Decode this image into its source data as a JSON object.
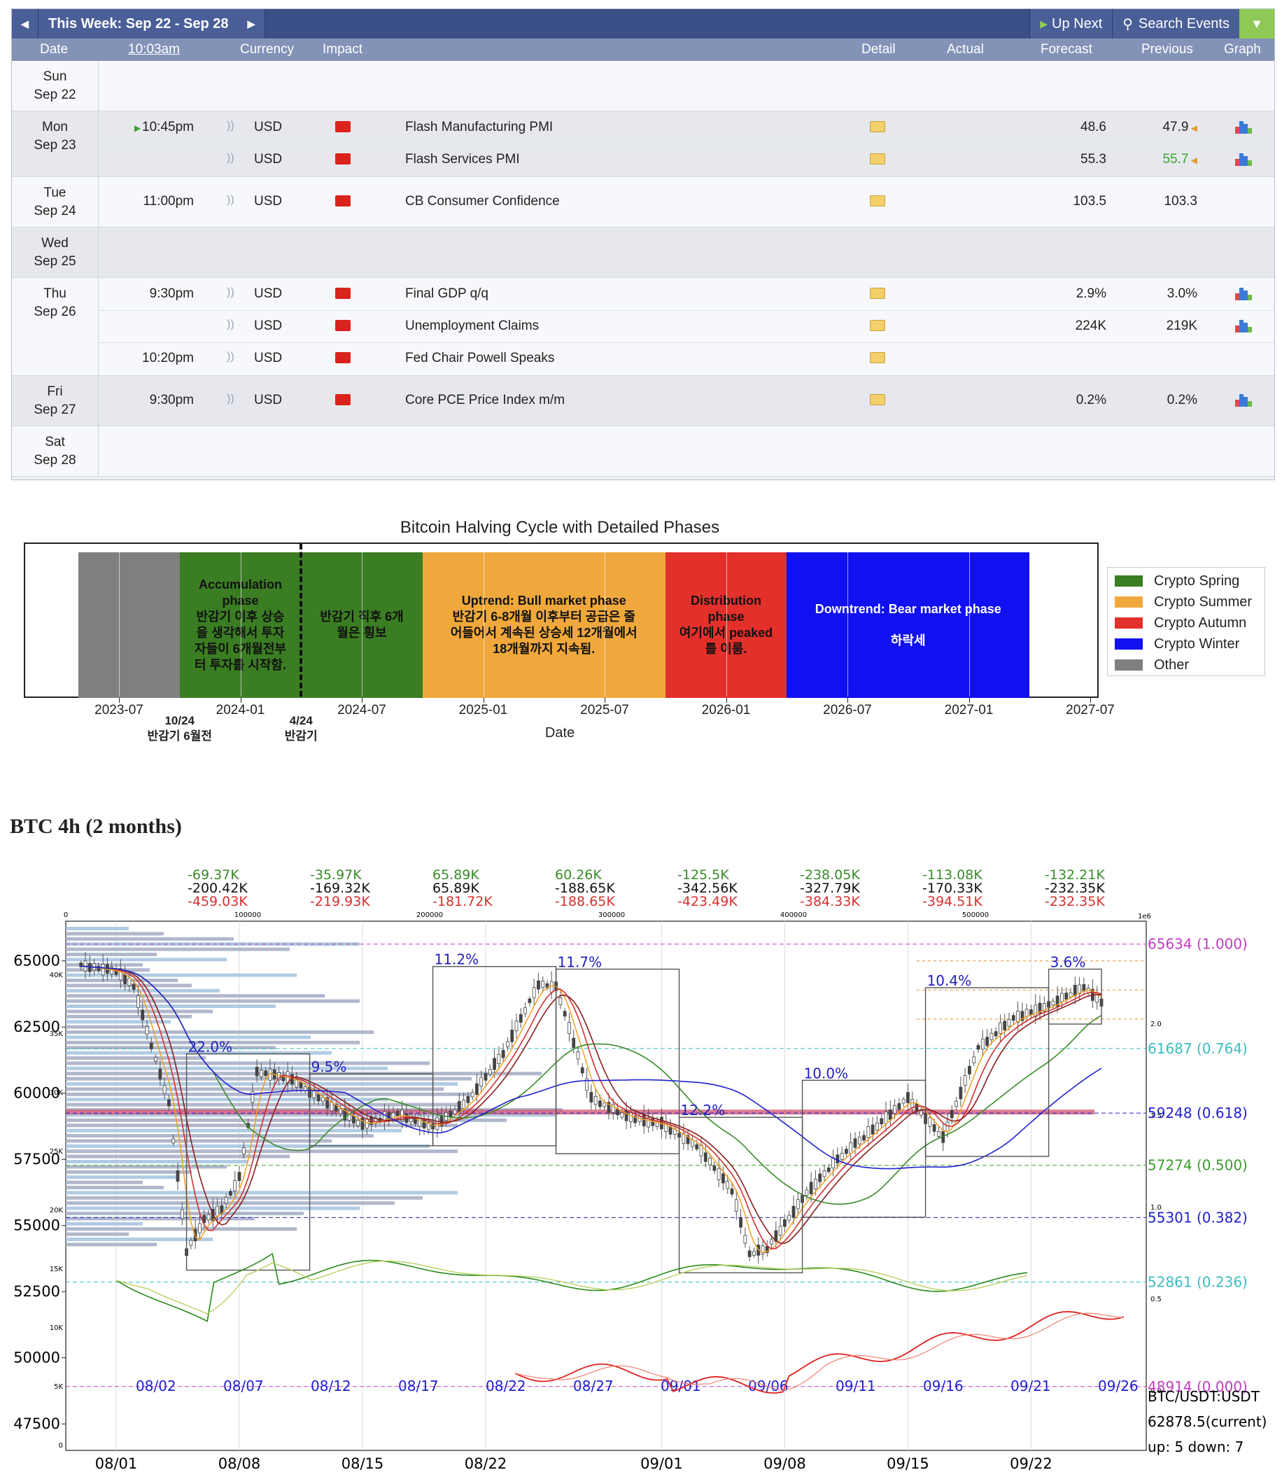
{
  "calendar": {
    "week_label": "This Week: Sep 22 - Sep 28",
    "up_next": "Up Next",
    "search": "Search Events",
    "headers": {
      "date": "Date",
      "time": "10:03am",
      "currency": "Currency",
      "impact": "Impact",
      "detail": "Detail",
      "actual": "Actual",
      "forecast": "Forecast",
      "previous": "Previous",
      "graph": "Graph"
    },
    "days": [
      {
        "dow": "Sun",
        "date": "Sep 22",
        "events": []
      },
      {
        "dow": "Mon",
        "date": "Sep 23",
        "events": [
          {
            "time": "10:45pm",
            "currency": "USD",
            "name": "Flash Manufacturing PMI",
            "actual": "",
            "forecast": "48.6",
            "previous": "47.9",
            "prev_color": "#222",
            "graph": true
          },
          {
            "time": "",
            "currency": "USD",
            "name": "Flash Services PMI",
            "actual": "",
            "forecast": "55.3",
            "previous": "55.7",
            "prev_color": "#3aa62e",
            "graph": true
          }
        ]
      },
      {
        "dow": "Tue",
        "date": "Sep 24",
        "events": [
          {
            "time": "11:00pm",
            "currency": "USD",
            "name": "CB Consumer Confidence",
            "actual": "",
            "forecast": "103.5",
            "previous": "103.3",
            "prev_color": "#222",
            "graph": false
          }
        ]
      },
      {
        "dow": "Wed",
        "date": "Sep 25",
        "events": []
      },
      {
        "dow": "Thu",
        "date": "Sep 26",
        "events": [
          {
            "time": "9:30pm",
            "currency": "USD",
            "name": "Final GDP q/q",
            "actual": "",
            "forecast": "2.9%",
            "previous": "3.0%",
            "prev_color": "#222",
            "graph": true
          },
          {
            "time": "",
            "currency": "USD",
            "name": "Unemployment Claims",
            "actual": "",
            "forecast": "224K",
            "previous": "219K",
            "prev_color": "#222",
            "graph": true
          },
          {
            "time": "10:20pm",
            "currency": "USD",
            "name": "Fed Chair Powell Speaks",
            "actual": "",
            "forecast": "",
            "previous": "",
            "prev_color": "#222",
            "graph": false
          }
        ]
      },
      {
        "dow": "Fri",
        "date": "Sep 27",
        "events": [
          {
            "time": "9:30pm",
            "currency": "USD",
            "name": "Core PCE Price Index m/m",
            "actual": "",
            "forecast": "0.2%",
            "previous": "0.2%",
            "prev_color": "#222",
            "graph": true
          }
        ]
      },
      {
        "dow": "Sat",
        "date": "Sep 28",
        "events": []
      }
    ]
  },
  "halving": {
    "title": "Bitcoin Halving Cycle with Detailed Phases",
    "xlabel": "Date",
    "x_ticks": [
      "2023-07",
      "2024-01",
      "2024-07",
      "2025-01",
      "2025-07",
      "2026-01",
      "2026-07",
      "2027-01",
      "2027-07"
    ],
    "phases": [
      {
        "category": "Other",
        "start": "2023-05",
        "end": "2023-10",
        "text": []
      },
      {
        "category": "Crypto Spring",
        "start": "2023-10",
        "end": "2024-04",
        "text": [
          "Accumulation",
          "phase",
          "반감기 이후 상승",
          "을 생각해서 투자",
          "자들이 6개월전부",
          "터 투자를 시작함."
        ]
      },
      {
        "category": "Crypto Spring",
        "start": "2024-04",
        "end": "2024-10",
        "text": [
          "반감기 직후 6개",
          "월은 횡보"
        ]
      },
      {
        "category": "Crypto Summer",
        "start": "2024-10",
        "end": "2025-10",
        "text": [
          "Uptrend: Bull market phase",
          "반감기 6-8개월 이후부터 공급은 줄",
          "어들어서 계속된 상승세 12개월에서",
          "18개월까지 지속됨."
        ]
      },
      {
        "category": "Crypto Autumn",
        "start": "2025-10",
        "end": "2026-04",
        "text": [
          "Distribution",
          "phase",
          "여기에서 peaked",
          "를 이룸."
        ]
      },
      {
        "category": "Crypto Winter",
        "start": "2026-04",
        "end": "2027-04",
        "text": [
          "Downtrend: Bear market phase",
          "",
          "하락세"
        ]
      }
    ],
    "annotations": [
      {
        "date": "2023-10",
        "lines": [
          "10/24",
          "반감기 6월전"
        ]
      },
      {
        "date": "2024-04",
        "lines": [
          "4/24",
          "반감기"
        ]
      }
    ],
    "legend": [
      {
        "label": "Crypto Spring",
        "color": "#3a7d22"
      },
      {
        "label": "Crypto Summer",
        "color": "#f0a83c"
      },
      {
        "label": "Crypto Autumn",
        "color": "#e3302a"
      },
      {
        "label": "Crypto Winter",
        "color": "#1010f0"
      },
      {
        "label": "Other",
        "color": "#7f7f7f"
      }
    ]
  },
  "btc": {
    "title": "BTC 4h (2 months)",
    "symbol": "BTC/USDT:USDT",
    "current": "62878.5(current)",
    "updown": "up: 5 down: 7"
  },
  "chart_data": [
    {
      "type": "table",
      "title": "This Week: Sep 22 - Sep 28",
      "columns": [
        "Date",
        "Time",
        "Currency",
        "Event",
        "Forecast",
        "Previous"
      ],
      "rows": [
        [
          "Mon Sep 23",
          "10:45pm",
          "USD",
          "Flash Manufacturing PMI",
          "48.6",
          "47.9"
        ],
        [
          "Mon Sep 23",
          "",
          "USD",
          "Flash Services PMI",
          "55.3",
          "55.7"
        ],
        [
          "Tue Sep 24",
          "11:00pm",
          "USD",
          "CB Consumer Confidence",
          "103.5",
          "103.3"
        ],
        [
          "Thu Sep 26",
          "9:30pm",
          "USD",
          "Final GDP q/q",
          "2.9%",
          "3.0%"
        ],
        [
          "Thu Sep 26",
          "",
          "USD",
          "Unemployment Claims",
          "224K",
          "219K"
        ],
        [
          "Thu Sep 26",
          "10:20pm",
          "USD",
          "Fed Chair Powell Speaks",
          "",
          ""
        ],
        [
          "Fri Sep 27",
          "9:30pm",
          "USD",
          "Core PCE Price Index m/m",
          "0.2%",
          "0.2%"
        ]
      ]
    },
    {
      "type": "bar",
      "title": "Bitcoin Halving Cycle with Detailed Phases",
      "xlabel": "Date",
      "categories": [
        "Other",
        "Crypto Spring",
        "Crypto Spring",
        "Crypto Summer",
        "Crypto Autumn",
        "Crypto Winter"
      ],
      "x_start": [
        "2023-05",
        "2023-10",
        "2024-04",
        "2024-10",
        "2025-10",
        "2026-04"
      ],
      "x_end": [
        "2023-10",
        "2024-04",
        "2024-10",
        "2025-10",
        "2026-04",
        "2027-04"
      ],
      "xlim": [
        "2023-01",
        "2027-08"
      ],
      "x_ticks": [
        "2023-07",
        "2024-01",
        "2024-07",
        "2025-01",
        "2025-07",
        "2026-01",
        "2026-07",
        "2027-01",
        "2027-07"
      ],
      "legend": "right"
    },
    {
      "type": "line",
      "title": "BTC 4h (2 months)",
      "ylim": [
        46500,
        66500
      ],
      "y_ticks": [
        47500,
        50000,
        52500,
        55000,
        57500,
        60000,
        62500,
        65000
      ],
      "x_ticks": [
        "08/01",
        "08/08",
        "08/15",
        "08/22",
        "09/01",
        "09/08",
        "09/15",
        "09/22"
      ],
      "inner_x_labels": [
        "08/02",
        "08/07",
        "08/12",
        "08/17",
        "08/22",
        "08/27",
        "09/01",
        "09/06",
        "09/11",
        "09/16",
        "09/21",
        "09/26"
      ],
      "series": [
        {
          "x": [
            "07/30",
            "08/01",
            "08/02",
            "08/03",
            "08/04",
            "08/05",
            "08/06",
            "08/07",
            "08/08",
            "08/09",
            "08/11",
            "08/13",
            "08/15",
            "08/17",
            "08/19",
            "08/21",
            "08/23",
            "08/25",
            "08/26",
            "08/28",
            "08/30",
            "09/01",
            "09/03",
            "09/05",
            "09/06",
            "09/07",
            "09/09",
            "09/11",
            "09/13",
            "09/15",
            "09/17",
            "09/19",
            "09/21",
            "09/23",
            "09/25",
            "09/26"
          ],
          "values": [
            64800,
            64600,
            64000,
            61800,
            59600,
            54000,
            55200,
            55600,
            56800,
            60800,
            60500,
            59600,
            58800,
            59200,
            58700,
            59700,
            61500,
            64100,
            64000,
            59800,
            59100,
            58800,
            58000,
            56300,
            53900,
            54100,
            56000,
            57500,
            58600,
            59800,
            58300,
            61700,
            62800,
            63300,
            64000,
            63400
          ]
        }
      ],
      "percent_boxes": [
        {
          "label": "22.0%",
          "from": "08/05",
          "to": "08/12"
        },
        {
          "label": "9.5%",
          "from": "08/12",
          "to": "08/19"
        },
        {
          "label": "11.2%",
          "from": "08/19",
          "to": "08/26"
        },
        {
          "label": "11.7%",
          "from": "08/26",
          "to": "09/02"
        },
        {
          "label": "12.2%",
          "from": "09/02",
          "to": "09/09"
        },
        {
          "label": "10.0%",
          "from": "09/09",
          "to": "09/16"
        },
        {
          "label": "10.4%",
          "from": "09/16",
          "to": "09/23"
        },
        {
          "label": "3.6%",
          "from": "09/23",
          "to": "09/26"
        }
      ],
      "fibonacci": [
        {
          "price": 65634,
          "label": "65634 (1.000)",
          "color": "#c03cc0"
        },
        {
          "price": 61687,
          "label": "61687 (0.764)",
          "color": "#3cbdc0"
        },
        {
          "price": 59248,
          "label": "59248 (0.618)",
          "color": "#2020d0"
        },
        {
          "price": 57274,
          "label": "57274 (0.500)",
          "color": "#3a9d2e"
        },
        {
          "price": 55301,
          "label": "55301 (0.382)",
          "color": "#2020d0"
        },
        {
          "price": 52861,
          "label": "52861 (0.236)",
          "color": "#3cbdc0"
        },
        {
          "price": 48914,
          "label": "48914 (0.000)",
          "color": "#c03cc0"
        }
      ],
      "volume_flow_labels": [
        {
          "green": "-69.37K",
          "black": "-200.42K",
          "red": "-459.03K"
        },
        {
          "green": "-35.97K",
          "black": "-169.32K",
          "red": "-219.93K"
        },
        {
          "green": "65.89K",
          "black": "65.89K",
          "red": "-181.72K"
        },
        {
          "green": "60.26K",
          "black": "-188.65K",
          "red": "-188.65K"
        },
        {
          "green": "-125.5K",
          "black": "-342.56K",
          "red": "-423.49K"
        },
        {
          "green": "-238.05K",
          "black": "-327.79K",
          "red": "-384.33K"
        },
        {
          "green": "-113.08K",
          "black": "-170.33K",
          "red": "-394.51K"
        },
        {
          "green": "-132.21K",
          "black": "-232.35K",
          "red": "-232.35K"
        }
      ],
      "top_axis_ticks": [
        "0",
        "100000",
        "200000",
        "300000",
        "400000",
        "500000"
      ],
      "top_axis_scale": "1e6",
      "left_inner_ticks": [
        "40K",
        "35K",
        "30K",
        "25K",
        "20K",
        "15K",
        "10K",
        "5K",
        "0"
      ],
      "right_inner_ticks": [
        "2.0",
        "1.5",
        "1.0",
        "0.5",
        "0.0"
      ]
    }
  ]
}
